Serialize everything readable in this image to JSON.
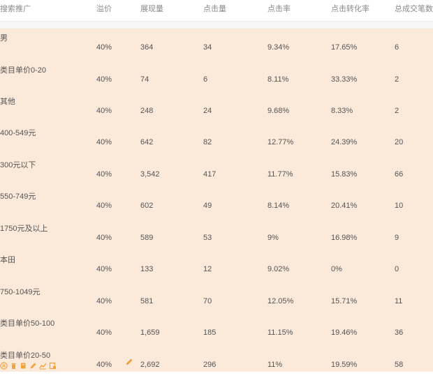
{
  "columns": [
    "搜索推广",
    "溢价",
    "展现量",
    "点击量",
    "点击率",
    "点击转化率",
    "总成交笔数"
  ],
  "rows": [
    {
      "name": "男",
      "premium": "40%",
      "impressions": "364",
      "clicks": "34",
      "ctr": "9.34%",
      "cvr": "17.65%",
      "orders": "6"
    },
    {
      "name": "类目单价0-20",
      "premium": "40%",
      "impressions": "74",
      "clicks": "6",
      "ctr": "8.11%",
      "cvr": "33.33%",
      "orders": "2"
    },
    {
      "name": "其他",
      "premium": "40%",
      "impressions": "248",
      "clicks": "24",
      "ctr": "9.68%",
      "cvr": "8.33%",
      "orders": "2"
    },
    {
      "name": "400-549元",
      "premium": "40%",
      "impressions": "642",
      "clicks": "82",
      "ctr": "12.77%",
      "cvr": "24.39%",
      "orders": "20"
    },
    {
      "name": "300元以下",
      "premium": "40%",
      "impressions": "3,542",
      "clicks": "417",
      "ctr": "11.77%",
      "cvr": "15.83%",
      "orders": "66"
    },
    {
      "name": "550-749元",
      "premium": "40%",
      "impressions": "602",
      "clicks": "49",
      "ctr": "8.14%",
      "cvr": "20.41%",
      "orders": "10"
    },
    {
      "name": "1750元及以上",
      "premium": "40%",
      "impressions": "589",
      "clicks": "53",
      "ctr": "9%",
      "cvr": "16.98%",
      "orders": "9"
    },
    {
      "name": "本田",
      "premium": "40%",
      "impressions": "133",
      "clicks": "12",
      "ctr": "9.02%",
      "cvr": "0%",
      "orders": "0"
    },
    {
      "name": "750-1049元",
      "premium": "40%",
      "impressions": "581",
      "clicks": "70",
      "ctr": "12.05%",
      "cvr": "15.71%",
      "orders": "11"
    },
    {
      "name": "类目单价50-100",
      "premium": "40%",
      "impressions": "1,659",
      "clicks": "185",
      "ctr": "11.15%",
      "cvr": "19.46%",
      "orders": "36"
    },
    {
      "name": "类目单价20-50",
      "premium": "40%",
      "impressions": "2,692",
      "clicks": "296",
      "ctr": "11%",
      "cvr": "19.59%",
      "orders": "58"
    }
  ],
  "icons": {
    "edit": "pencil-icon",
    "toolbar": [
      "pause-icon",
      "trash-icon",
      "copy-icon",
      "pencil-icon",
      "chart-icon",
      "report-icon"
    ]
  },
  "colors": {
    "row_background": "#fbe9da",
    "icon_orange": "#f2a23a"
  }
}
